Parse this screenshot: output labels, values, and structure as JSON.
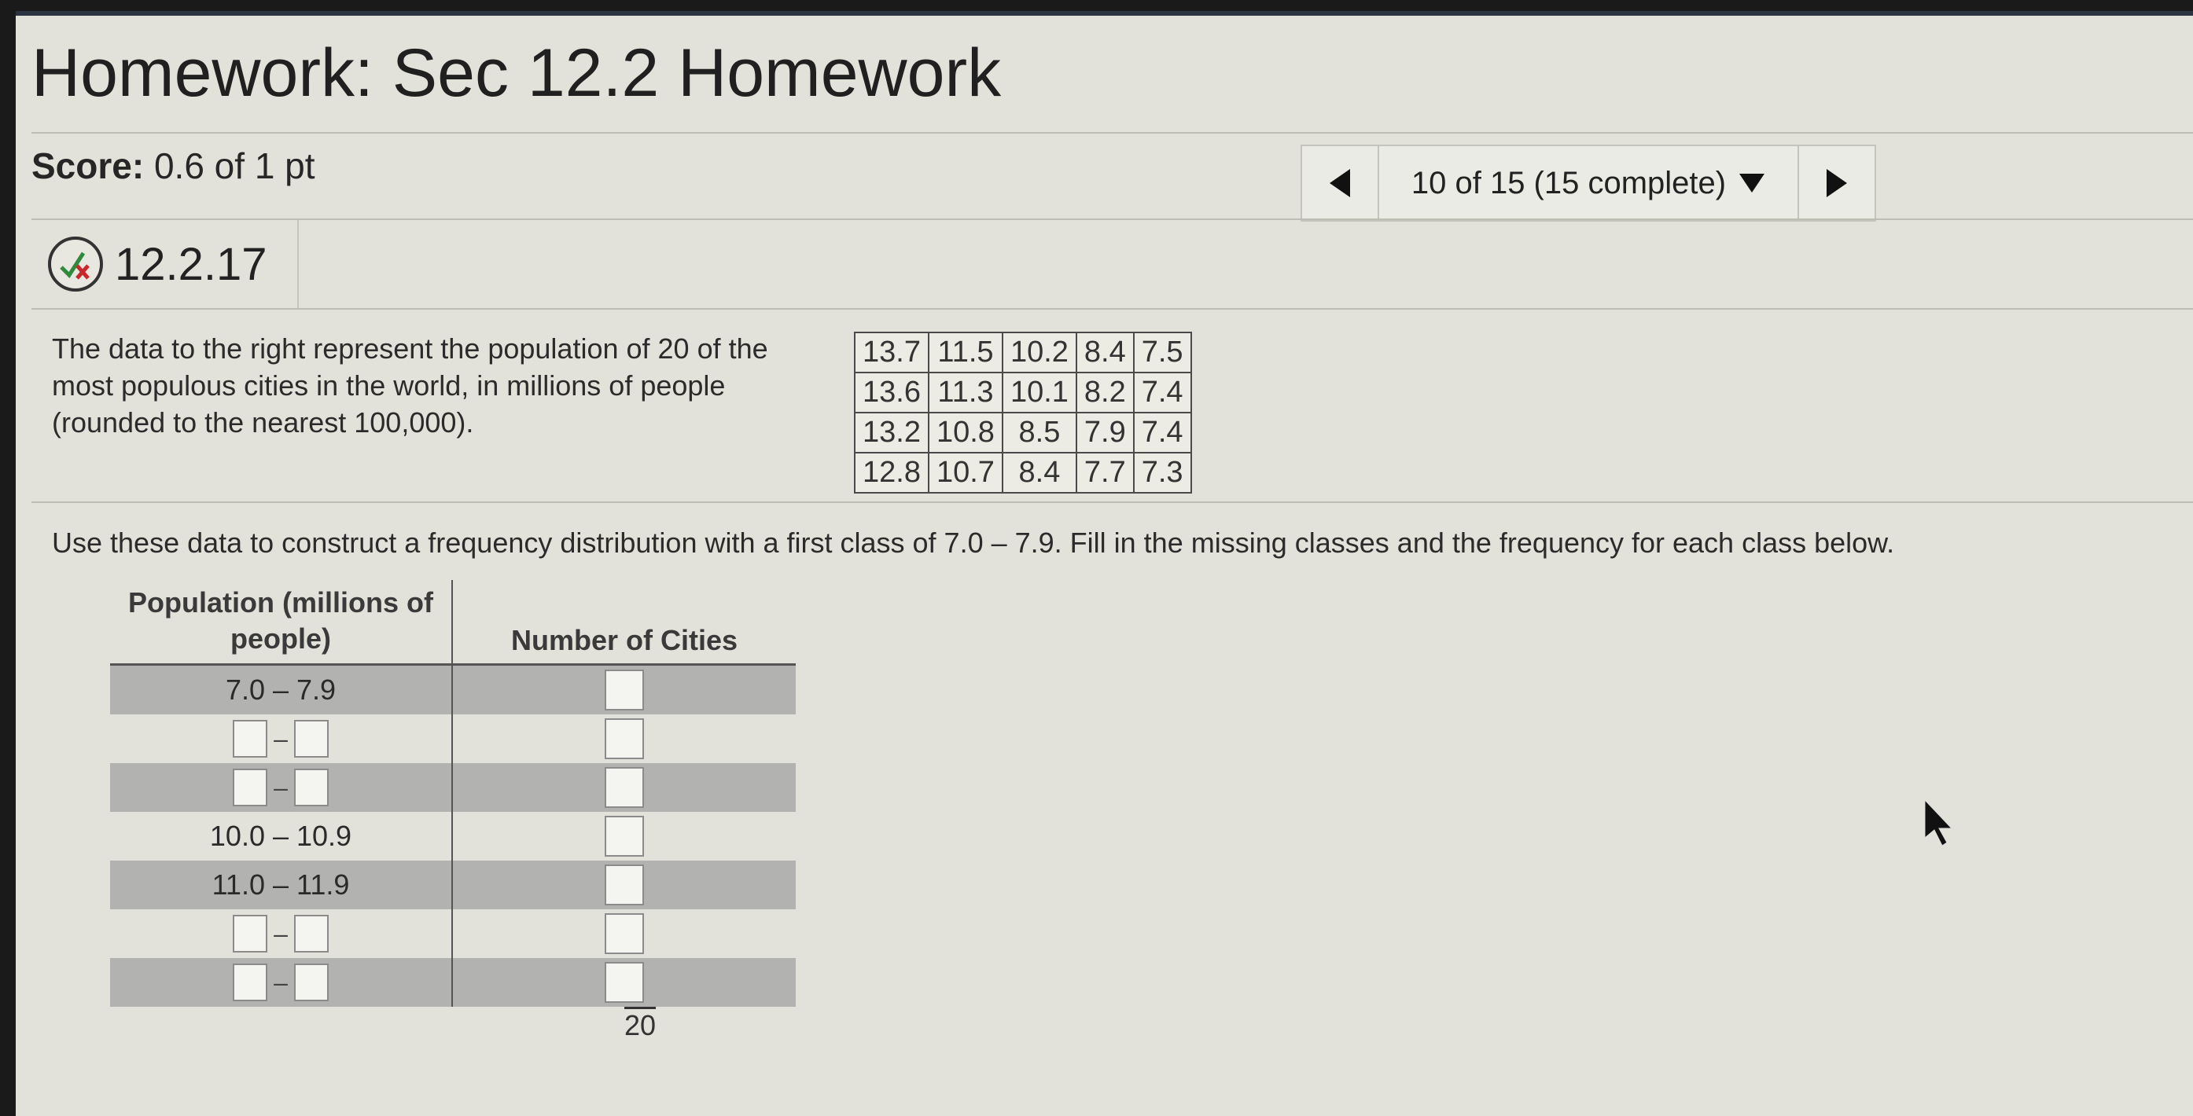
{
  "header": {
    "title": "Homework: Sec 12.2 Homework"
  },
  "score": {
    "label": "Score:",
    "value": "0.6 of 1 pt"
  },
  "nav": {
    "status": "10 of 15 (15 complete)",
    "prev_icon": "triangle-left-icon",
    "next_icon": "triangle-right-icon",
    "dropdown_icon": "triangle-down-icon"
  },
  "question": {
    "number": "12.2.17",
    "status_icon": "partial-credit-icon"
  },
  "problem": {
    "text": "The data to the right represent the population of 20 of the most populous cities in the world, in millions of people (rounded to the nearest 100,000).",
    "data": [
      [
        "13.7",
        "11.5",
        "10.2",
        "8.4",
        "7.5"
      ],
      [
        "13.6",
        "11.3",
        "10.1",
        "8.2",
        "7.4"
      ],
      [
        "13.2",
        "10.8",
        "8.5",
        "7.9",
        "7.4"
      ],
      [
        "12.8",
        "10.7",
        "8.4",
        "7.7",
        "7.3"
      ]
    ]
  },
  "instruction": "Use these data to construct a frequency distribution with a first class of 7.0 – 7.9. Fill in the missing classes and the frequency for each class below.",
  "freq_table": {
    "col1_header": "Population (millions of people)",
    "col2_header": "Number of Cities",
    "rows": [
      {
        "class": "7.0 – 7.9"
      },
      {
        "class": null
      },
      {
        "class": null
      },
      {
        "class": "10.0 – 10.9"
      },
      {
        "class": "11.0 – 11.9"
      },
      {
        "class": null
      },
      {
        "class": null
      }
    ],
    "total": "20",
    "dash": "–"
  },
  "colors": {
    "background": "#e3e2da",
    "shaded_row": "#b2b2b0",
    "top_bar": "#2c3442"
  }
}
